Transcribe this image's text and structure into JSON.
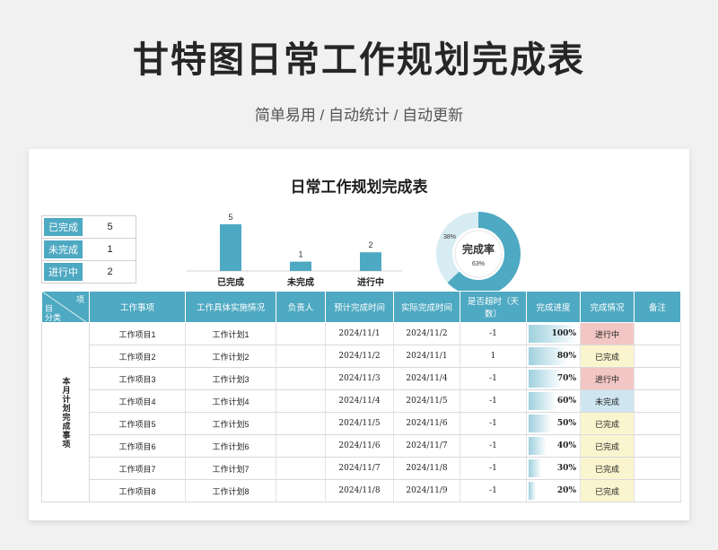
{
  "page": {
    "title": "甘特图日常工作规划完成表",
    "subtitle": "简单易用 / 自动统计 / 自动更新"
  },
  "sheet": {
    "title": "日常工作规划完成表",
    "status": [
      {
        "label": "已完成",
        "value": "5"
      },
      {
        "label": "未完成",
        "value": "1"
      },
      {
        "label": "进行中",
        "value": "2"
      }
    ],
    "donut": {
      "label": "完成率",
      "percent": "63%",
      "side_percent": "38%"
    }
  },
  "chart_data": {
    "type": "bar",
    "categories": [
      "已完成",
      "未完成",
      "进行中"
    ],
    "values": [
      5,
      1,
      2
    ],
    "ylim": [
      0,
      5
    ],
    "color": "#4ea9c2"
  },
  "table": {
    "corner": {
      "top": "项",
      "mid": "目",
      "bottom": "分类"
    },
    "headers": [
      "工作事项",
      "工作具体实施情况",
      "负责人",
      "预计完成时间",
      "实际完成时间",
      "是否超时（天数）",
      "完成进度",
      "完成情况",
      "备注"
    ],
    "category": "本月计划完成事项",
    "rows": [
      {
        "item": "工作项目1",
        "plan": "工作计划1",
        "owner": "",
        "expected": "2024/11/1",
        "actual": "2024/11/2",
        "overdue": "-1",
        "overdue_red": false,
        "progress": "100%",
        "pct": 1.0,
        "status": "进行中",
        "status_type": "doing"
      },
      {
        "item": "工作项目2",
        "plan": "工作计划2",
        "owner": "",
        "expected": "2024/11/2",
        "actual": "2024/11/1",
        "overdue": "1",
        "overdue_red": true,
        "progress": "80%",
        "pct": 0.8,
        "status": "已完成",
        "status_type": "done"
      },
      {
        "item": "工作项目3",
        "plan": "工作计划3",
        "owner": "",
        "expected": "2024/11/3",
        "actual": "2024/11/4",
        "overdue": "-1",
        "overdue_red": false,
        "progress": "70%",
        "pct": 0.7,
        "status": "进行中",
        "status_type": "doing"
      },
      {
        "item": "工作项目4",
        "plan": "工作计划4",
        "owner": "",
        "expected": "2024/11/4",
        "actual": "2024/11/5",
        "overdue": "-1",
        "overdue_red": false,
        "progress": "60%",
        "pct": 0.6,
        "status": "未完成",
        "status_type": "todo"
      },
      {
        "item": "工作项目5",
        "plan": "工作计划5",
        "owner": "",
        "expected": "2024/11/5",
        "actual": "2024/11/6",
        "overdue": "-1",
        "overdue_red": false,
        "progress": "50%",
        "pct": 0.5,
        "status": "已完成",
        "status_type": "done"
      },
      {
        "item": "工作项目6",
        "plan": "工作计划6",
        "owner": "",
        "expected": "2024/11/6",
        "actual": "2024/11/7",
        "overdue": "-1",
        "overdue_red": false,
        "progress": "40%",
        "pct": 0.4,
        "status": "已完成",
        "status_type": "done"
      },
      {
        "item": "工作项目7",
        "plan": "工作计划7",
        "owner": "",
        "expected": "2024/11/7",
        "actual": "2024/11/8",
        "overdue": "-1",
        "overdue_red": false,
        "progress": "30%",
        "pct": 0.3,
        "status": "已完成",
        "status_type": "done"
      },
      {
        "item": "工作项目8",
        "plan": "工作计划8",
        "owner": "",
        "expected": "2024/11/8",
        "actual": "2024/11/9",
        "overdue": "-1",
        "overdue_red": false,
        "progress": "20%",
        "pct": 0.2,
        "status": "已完成",
        "status_type": "done"
      }
    ]
  }
}
